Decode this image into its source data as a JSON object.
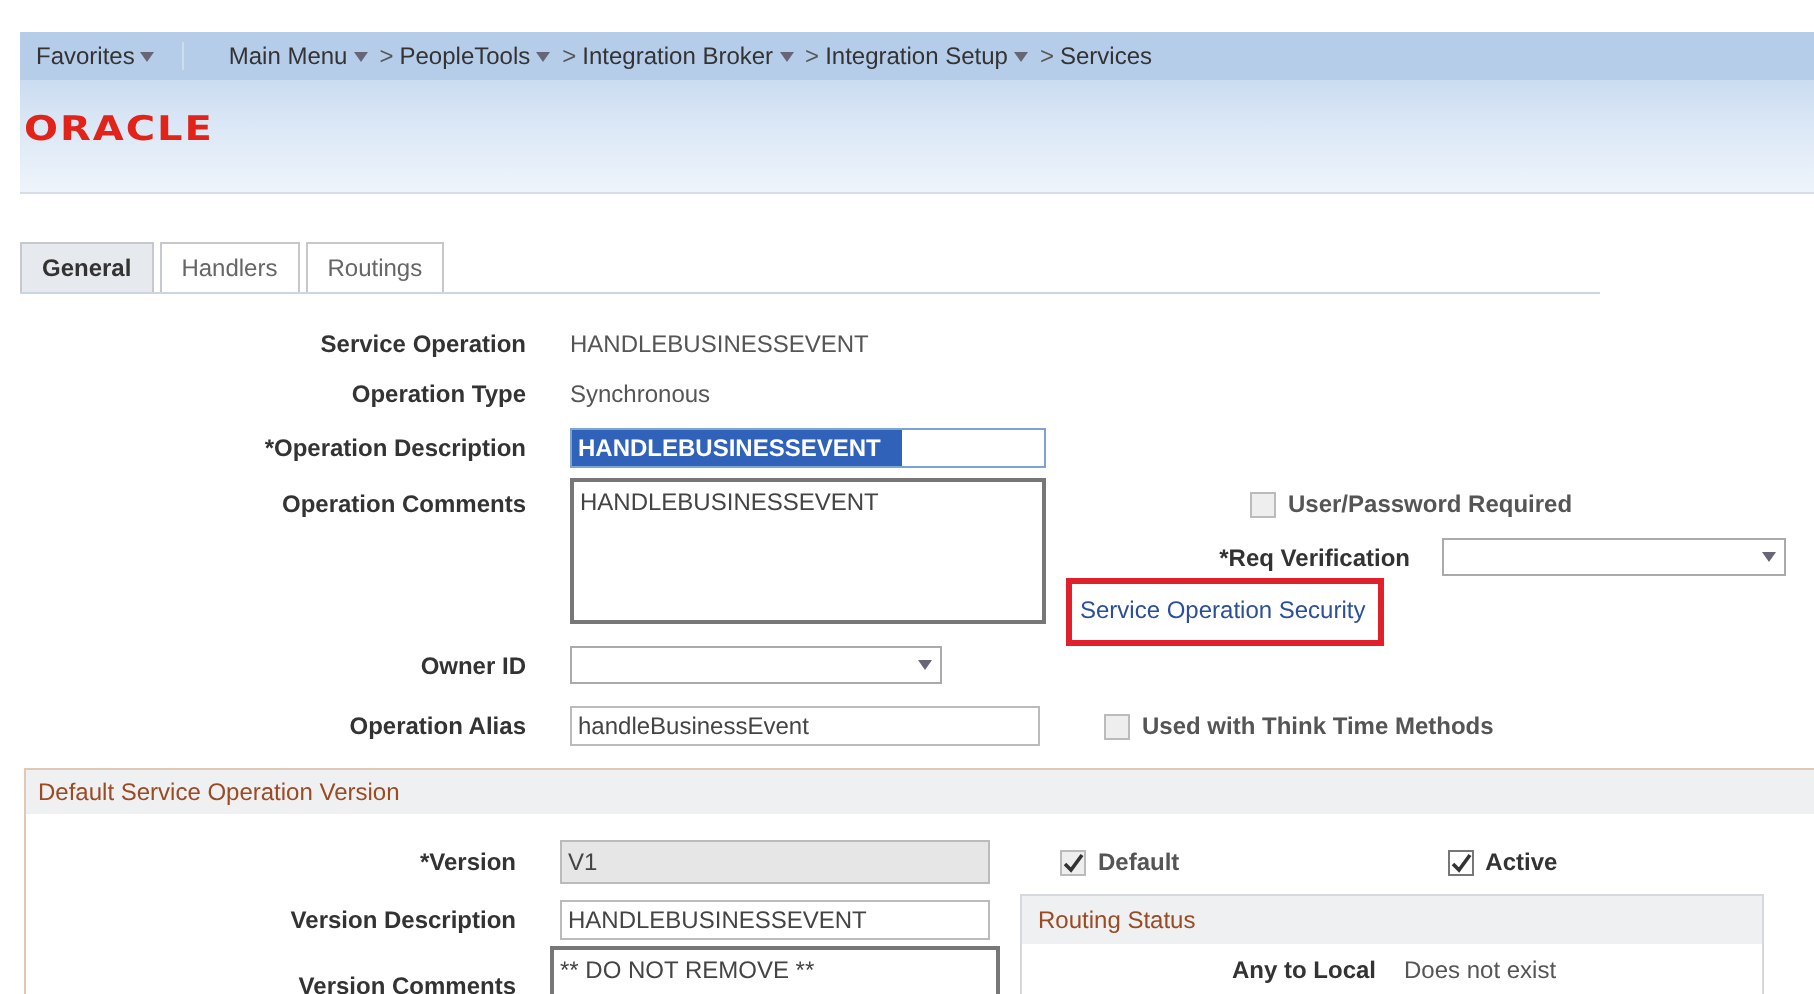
{
  "nav": {
    "items": [
      {
        "label": "Favorites",
        "has_menu": true
      },
      {
        "label": "Main Menu",
        "has_menu": true
      },
      {
        "prefix": ">",
        "label": "PeopleTools",
        "has_menu": true
      },
      {
        "prefix": ">",
        "label": "Integration Broker",
        "has_menu": true
      },
      {
        "prefix": ">",
        "label": "Integration Setup",
        "has_menu": true
      },
      {
        "prefix": ">",
        "label": "Services",
        "has_menu": false
      }
    ]
  },
  "logo": "ORACLE",
  "tabs": [
    {
      "label": "General",
      "selected": true
    },
    {
      "label": "Handlers",
      "selected": false
    },
    {
      "label": "Routings",
      "selected": false
    }
  ],
  "service_operation": {
    "label": "Service Operation",
    "value": "HANDLEBUSINESSEVENT"
  },
  "operation_type": {
    "label": "Operation Type",
    "value": "Synchronous"
  },
  "operation_description": {
    "label": "*Operation Description",
    "value": "HANDLEBUSINESSEVENT",
    "highlighted": true
  },
  "operation_comments": {
    "label": "Operation Comments",
    "value": "HANDLEBUSINESSEVENT"
  },
  "user_password_required": {
    "label": "User/Password Required",
    "checked": false,
    "disabled": true
  },
  "req_verification": {
    "label": "*Req Verification"
  },
  "security_link": {
    "label": "Service Operation Security",
    "outlined": true
  },
  "owner_id": {
    "label": "Owner ID"
  },
  "operation_alias": {
    "label": "Operation Alias",
    "value": "handleBusinessEvent"
  },
  "think_time": {
    "label": "Used with Think Time Methods",
    "checked": false,
    "disabled": true
  },
  "version_section": {
    "title": "Default Service Operation Version",
    "version": {
      "label": "*Version",
      "value": "V1"
    },
    "default": {
      "label": "Default",
      "checked": true,
      "disabled": true
    },
    "active": {
      "label": "Active",
      "checked": true,
      "disabled": false
    },
    "version_description": {
      "label": "Version Description",
      "value": "HANDLEBUSINESSEVENT"
    },
    "version_comments": {
      "label": "Version Comments",
      "value": "** DO NOT REMOVE **"
    },
    "routing_status": {
      "title": "Routing Status",
      "label": "Any to Local",
      "value": "Does not exist"
    }
  }
}
